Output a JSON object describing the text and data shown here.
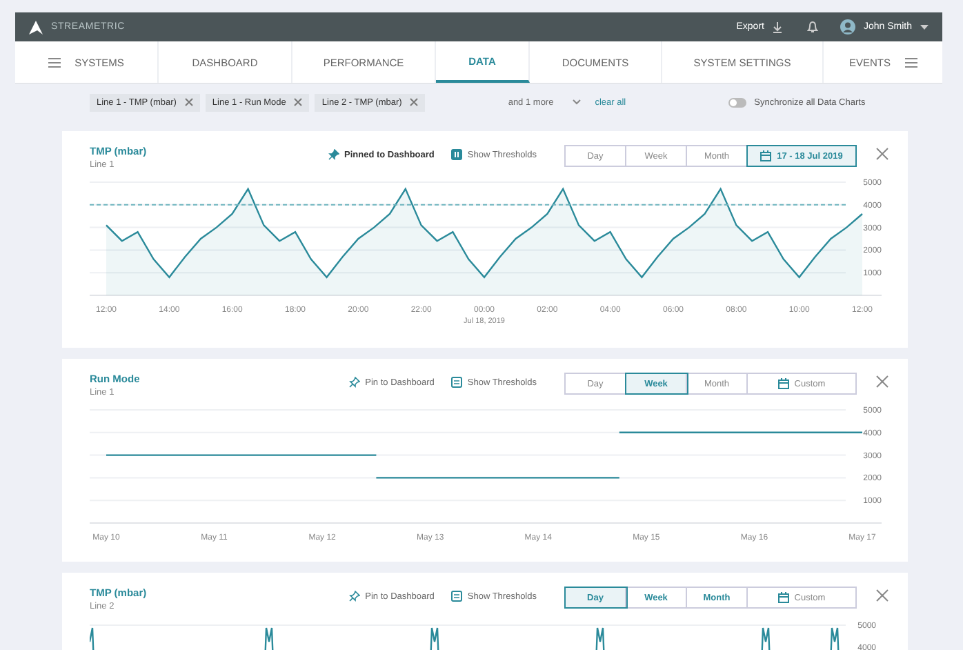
{
  "app": {
    "brand": "STREAMETRIC",
    "export": "Export",
    "user": "John Smith"
  },
  "nav": [
    {
      "label": "SYSTEMS",
      "selected": false,
      "kind": "menu-left"
    },
    {
      "label": "DASHBOARD",
      "selected": false,
      "kind": "plain"
    },
    {
      "label": "PERFORMANCE",
      "selected": false,
      "kind": "plain"
    },
    {
      "label": "DATA",
      "selected": true,
      "kind": "plain"
    },
    {
      "label": "DOCUMENTS",
      "selected": false,
      "kind": "plain"
    },
    {
      "label": "SYSTEM SETTINGS",
      "selected": false,
      "kind": "plain"
    },
    {
      "label": "EVENTS",
      "selected": false,
      "kind": "menu-right"
    }
  ],
  "filters": {
    "chips": [
      "Line 1 - TMP (mbar)",
      "Line 1 - Run Mode",
      "Line 2 - TMP (mbar)"
    ],
    "more": "and 1 more",
    "clear": "clear all",
    "sync": {
      "label": "Synchronize all Data Charts",
      "on": false
    }
  },
  "cards": [
    {
      "title": "TMP (mbar)",
      "subtitle": "Line 1",
      "pin": {
        "label": "Pinned to Dashboard",
        "pinned": true
      },
      "thresholds": {
        "label": "Show Thresholds",
        "on": true
      },
      "ranges": [
        {
          "label": "Day",
          "selected": false,
          "emphasized": false,
          "kind": "text"
        },
        {
          "label": "Week",
          "selected": false,
          "emphasized": false,
          "kind": "text"
        },
        {
          "label": "Month",
          "selected": false,
          "emphasized": false,
          "kind": "text"
        },
        {
          "label": "17 - 18 Jul 2019",
          "selected": true,
          "emphasized": true,
          "kind": "date"
        }
      ],
      "chart_data": {
        "type": "area",
        "categories": [
          "12:00",
          null,
          null,
          null,
          "14:00",
          null,
          null,
          null,
          "16:00",
          null,
          null,
          null,
          "18:00",
          null,
          null,
          null,
          "20:00",
          null,
          null,
          null,
          "22:00",
          null,
          null,
          null,
          "00:00",
          null,
          null,
          null,
          "02:00",
          null,
          null,
          null,
          "04:00",
          null,
          null,
          null,
          "06:00",
          null,
          null,
          null,
          "08:00",
          null,
          null,
          null,
          "10:00",
          null,
          null,
          null,
          "12:00"
        ],
        "series": [
          {
            "color": "#2a8a9a",
            "values": [
              3100,
              2400,
              2800,
              1600,
              800,
              1700,
              2500,
              3000,
              3600,
              4700,
              3100,
              2400,
              2800,
              1600,
              800,
              1700,
              2500,
              3000,
              3600,
              4700,
              3100,
              2400,
              2800,
              1600,
              800,
              1700,
              2500,
              3000,
              3600,
              4700,
              3100,
              2400,
              2800,
              1600,
              800,
              1700,
              2500,
              3000,
              3600,
              4700,
              3100,
              2400,
              2800,
              1600,
              800,
              1700,
              2500,
              3000,
              3600
            ]
          }
        ],
        "ylim": [
          0,
          5000
        ],
        "grid": true,
        "yticks": [
          1000,
          2000,
          3000,
          4000,
          5000
        ],
        "ref_lines": [
          {
            "axis": "y",
            "value": 4000
          }
        ],
        "annotations": [
          "Jul 18, 2019"
        ]
      }
    },
    {
      "title": "Run Mode",
      "subtitle": "Line 1",
      "pin": {
        "label": "Pin to Dashboard",
        "pinned": false
      },
      "thresholds": {
        "label": "Show Thresholds",
        "on": false
      },
      "ranges": [
        {
          "label": "Day",
          "selected": false,
          "emphasized": false,
          "kind": "text"
        },
        {
          "label": "Week",
          "selected": true,
          "emphasized": true,
          "kind": "text"
        },
        {
          "label": "Month",
          "selected": false,
          "emphasized": false,
          "kind": "text"
        },
        {
          "label": "Custom",
          "selected": false,
          "emphasized": false,
          "kind": "date"
        }
      ],
      "chart_data": {
        "type": "line",
        "categories": [
          "May 10",
          null,
          null,
          null,
          "May 11",
          null,
          null,
          null,
          "May 12",
          null,
          null,
          null,
          "May 13",
          null,
          null,
          null,
          "May 14",
          null,
          null,
          null,
          "May 15",
          null,
          null,
          null,
          "May 16",
          null,
          null,
          null,
          "May 17"
        ],
        "series": [
          {
            "color": "#2a8a9a",
            "values": [
              3000,
              3000,
              3000,
              3000,
              3000,
              3000,
              3000,
              3000,
              3000,
              3000,
              3000,
              null,
              null,
              null,
              null,
              null,
              null,
              null,
              null,
              null,
              null,
              null,
              null,
              null,
              null,
              null,
              null,
              null,
              null
            ]
          },
          {
            "color": "#2a8a9a",
            "values": [
              null,
              null,
              null,
              null,
              null,
              null,
              null,
              null,
              null,
              null,
              2000,
              2000,
              2000,
              2000,
              2000,
              2000,
              2000,
              2000,
              2000,
              2000,
              null,
              null,
              null,
              null,
              null,
              null,
              null,
              null,
              null
            ]
          },
          {
            "color": "#2a8a9a",
            "values": [
              null,
              null,
              null,
              null,
              null,
              null,
              null,
              null,
              null,
              null,
              null,
              null,
              null,
              null,
              null,
              null,
              null,
              null,
              null,
              4000,
              4000,
              4000,
              4000,
              4000,
              4000,
              4000,
              4000,
              4000,
              4000
            ]
          }
        ],
        "ylim": [
          0,
          5000
        ],
        "grid": true,
        "yticks": [
          1000,
          2000,
          3000,
          4000,
          5000
        ]
      }
    },
    {
      "title": "TMP (mbar)",
      "subtitle": "Line 2",
      "pin": {
        "label": "Pin to Dashboard",
        "pinned": false
      },
      "thresholds": {
        "label": "Show Thresholds",
        "on": false
      },
      "ranges": [
        {
          "label": "Day",
          "selected": true,
          "emphasized": true,
          "kind": "text"
        },
        {
          "label": "Week",
          "selected": false,
          "emphasized": true,
          "kind": "text"
        },
        {
          "label": "Month",
          "selected": false,
          "emphasized": true,
          "kind": "text"
        },
        {
          "label": "Custom",
          "selected": false,
          "emphasized": false,
          "kind": "date"
        }
      ],
      "preview": {
        "y_tick_labels": [
          "5000",
          "4000"
        ]
      }
    }
  ]
}
